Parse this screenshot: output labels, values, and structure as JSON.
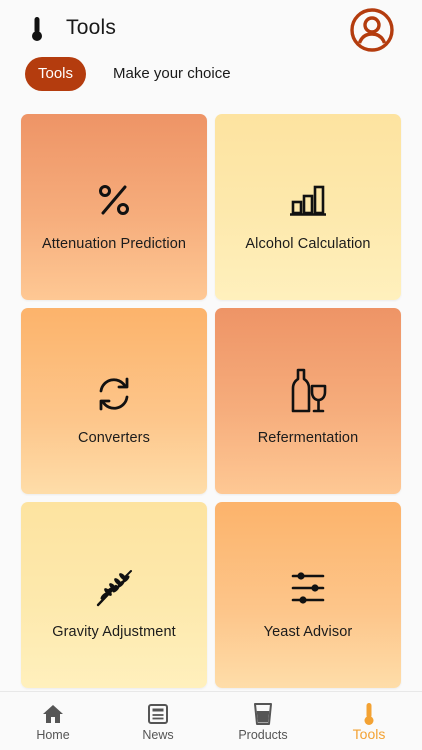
{
  "header": {
    "title": "Tools",
    "app_icon": "thermometer-icon",
    "profile_icon": "user-circle-icon"
  },
  "filters": {
    "active_chip": "Tools",
    "hint": "Make your choice"
  },
  "tools": [
    {
      "label": "Attenuation Prediction",
      "icon": "percent-icon"
    },
    {
      "label": "Alcohol Calculation",
      "icon": "bar-chart-icon"
    },
    {
      "label": "Converters",
      "icon": "refresh-icon"
    },
    {
      "label": "Refermentation",
      "icon": "bottle-glass-icon"
    },
    {
      "label": "Gravity Adjustment",
      "icon": "wheat-icon"
    },
    {
      "label": "Yeast Advisor",
      "icon": "sliders-icon"
    }
  ],
  "nav": {
    "items": [
      {
        "label": "Home",
        "icon": "home-icon"
      },
      {
        "label": "News",
        "icon": "newspaper-icon"
      },
      {
        "label": "Products",
        "icon": "glass-icon"
      },
      {
        "label": "Tools",
        "icon": "thermometer-icon"
      }
    ],
    "active": "Tools"
  },
  "colors": {
    "brand": "#b43c0e",
    "active_nav": "#f3a233",
    "card_coral": "#ee9466",
    "card_yellow": "#fde3a0",
    "card_orange": "#fcb36b"
  }
}
